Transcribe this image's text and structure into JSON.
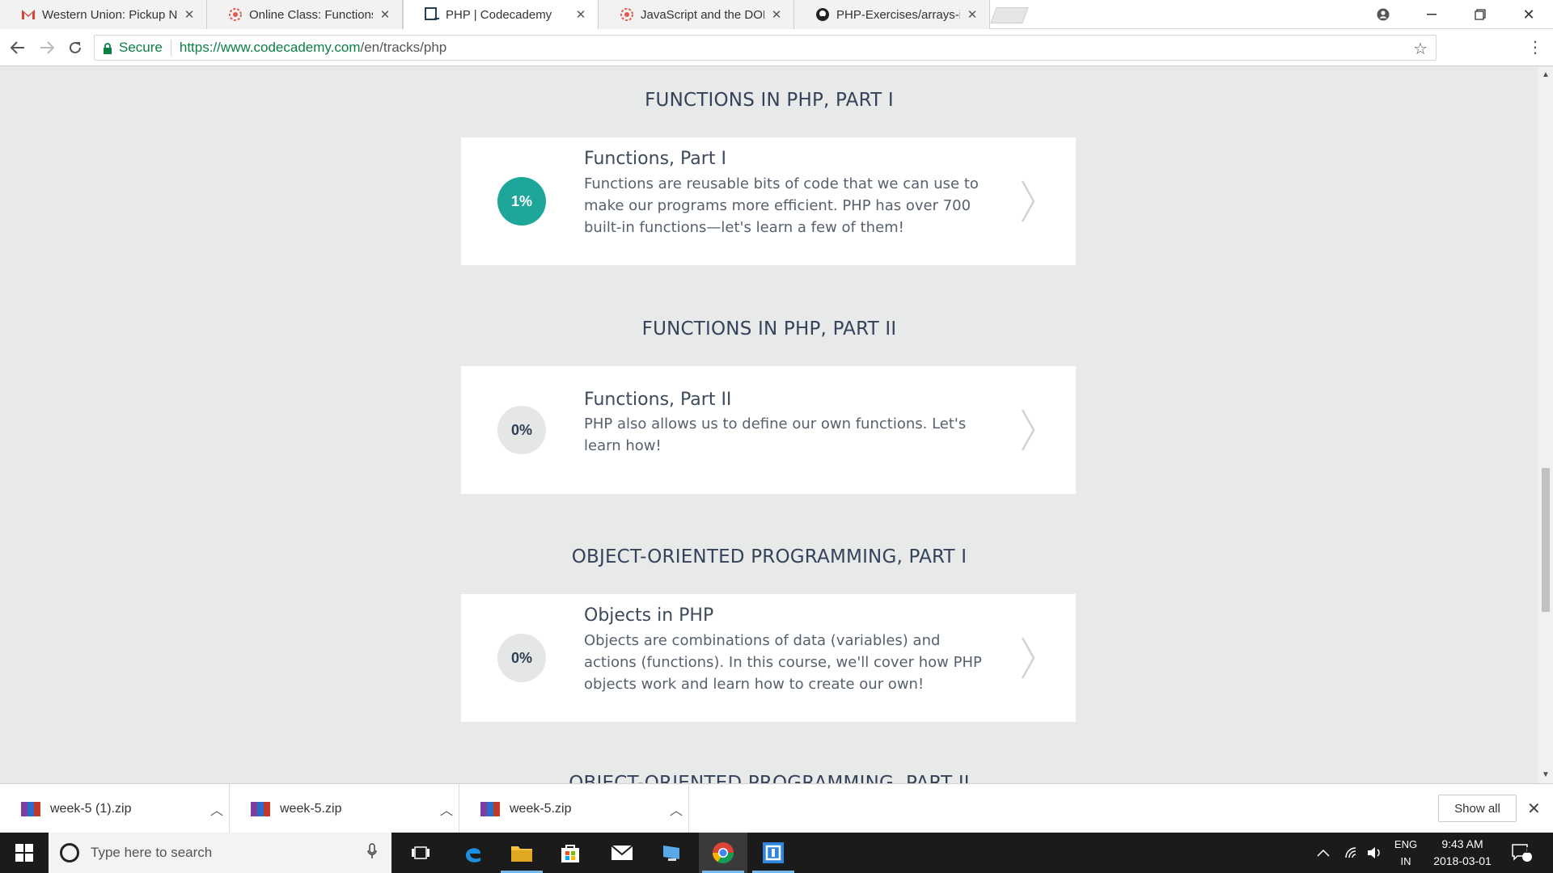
{
  "browser": {
    "tabs": [
      {
        "title": "Western Union: Pickup N",
        "icon": "gmail-icon",
        "active": false
      },
      {
        "title": "Online Class: Functions P",
        "icon": "udemy-icon",
        "active": false
      },
      {
        "title": "PHP | Codecademy",
        "icon": "codecademy-icon",
        "active": true
      },
      {
        "title": "JavaScript and the DOM",
        "icon": "udemy-icon",
        "active": false
      },
      {
        "title": "PHP-Exercises/arrays-in-",
        "icon": "github-icon",
        "active": false
      }
    ],
    "security_label": "Secure",
    "url_host": "https://www.codecademy.com",
    "url_path": "/en/tracks/php"
  },
  "sections": [
    {
      "heading": "FUNCTIONS IN PHP, PART I",
      "course_title": "Functions, Part I",
      "description": "Functions are reusable bits of code that we can use to make our programs more efficient. PHP has over 700 built-in functions—let's learn a few of them!",
      "progress_label": "1%",
      "progress": 0.01
    },
    {
      "heading": "FUNCTIONS IN PHP, PART II",
      "course_title": "Functions, Part II",
      "description": "PHP also allows us to define our own functions. Let's learn how!",
      "progress_label": "0%",
      "progress": 0
    },
    {
      "heading": "OBJECT-ORIENTED PROGRAMMING, PART I",
      "course_title": "Objects in PHP",
      "description": "Objects are combinations of data (variables) and actions (functions). In this course, we'll cover how PHP objects work and learn how to create our own!",
      "progress_label": "0%",
      "progress": 0
    },
    {
      "heading": "OBJECT-ORIENTED PROGRAMMING, PART II"
    }
  ],
  "downloads": {
    "items": [
      {
        "name": "week-5 (1).zip"
      },
      {
        "name": "week-5.zip"
      },
      {
        "name": "week-5.zip"
      }
    ],
    "show_all_label": "Show all"
  },
  "taskbar": {
    "search_placeholder": "Type here to search",
    "lang_line1": "ENG",
    "lang_line2": "IN",
    "time": "9:43 AM",
    "date": "2018-03-01",
    "notification_count": "1"
  },
  "colors": {
    "accent_teal": "#1ea69a",
    "secure_green": "#0b8043",
    "page_bg": "#e8e9e9"
  }
}
